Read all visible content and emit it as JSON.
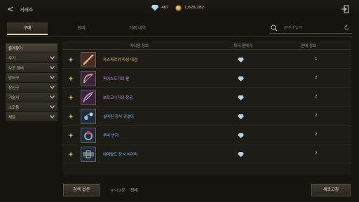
{
  "header": {
    "back_glyph": "<",
    "title": "거래소",
    "diamond_count": "467",
    "gold_count": "1,626,282"
  },
  "tabs": [
    {
      "label": "구매",
      "active": true
    },
    {
      "label": "판매",
      "active": false
    },
    {
      "label": "거래 내역",
      "active": false
    }
  ],
  "search": {
    "placeholder": "검색어 입력"
  },
  "sidebar": {
    "items": [
      {
        "label": "즐겨찾기",
        "active": true,
        "has_chevron": false
      },
      {
        "label": "무기",
        "active": false,
        "has_chevron": true
      },
      {
        "label": "보조 장비",
        "active": false,
        "has_chevron": true
      },
      {
        "label": "방어구",
        "active": false,
        "has_chevron": true
      },
      {
        "label": "장신구",
        "active": false,
        "has_chevron": true
      },
      {
        "label": "기술서",
        "active": false,
        "has_chevron": true
      },
      {
        "label": "소모품",
        "active": false,
        "has_chevron": true
      },
      {
        "label": "재료",
        "active": false,
        "has_chevron": true
      }
    ]
  },
  "table": {
    "headers": {
      "info": "아이템 정보",
      "price": "최저 판매가",
      "count": "판매 정보"
    },
    "rows": [
      {
        "name": "카스파르의 마성 대검",
        "name_color": "#e8c37a",
        "qty": "1",
        "icon": "greatsword-icon"
      },
      {
        "name": "피어스드가의 활",
        "name_color": "#c79bf0",
        "qty": "2",
        "icon": "bow-icon"
      },
      {
        "name": "보르고니가의 창궁",
        "name_color": "#c79bf0",
        "qty": "2",
        "icon": "crossbow-icon"
      },
      {
        "name": "실버린 장식 귀걸이",
        "name_color": "#7fb6ee",
        "qty": "2",
        "icon": "earring-icon"
      },
      {
        "name": "루비 반지",
        "name_color": "#7fb6ee",
        "qty": "2",
        "icon": "ring-icon"
      },
      {
        "name": "에메랄드 장식 허리띠",
        "name_color": "#7fb6ee",
        "qty": "2",
        "icon": "belt-icon"
      }
    ]
  },
  "footer": {
    "search_option_label": "검색 옵션",
    "result_count": "0~12강",
    "result_scope": "전체",
    "refresh_label": "새로고침"
  },
  "colors": {
    "background": "#16140f",
    "accent_gold": "#e8c37a",
    "rarity_purple": "#c79bf0",
    "rarity_blue": "#7fb6ee"
  }
}
